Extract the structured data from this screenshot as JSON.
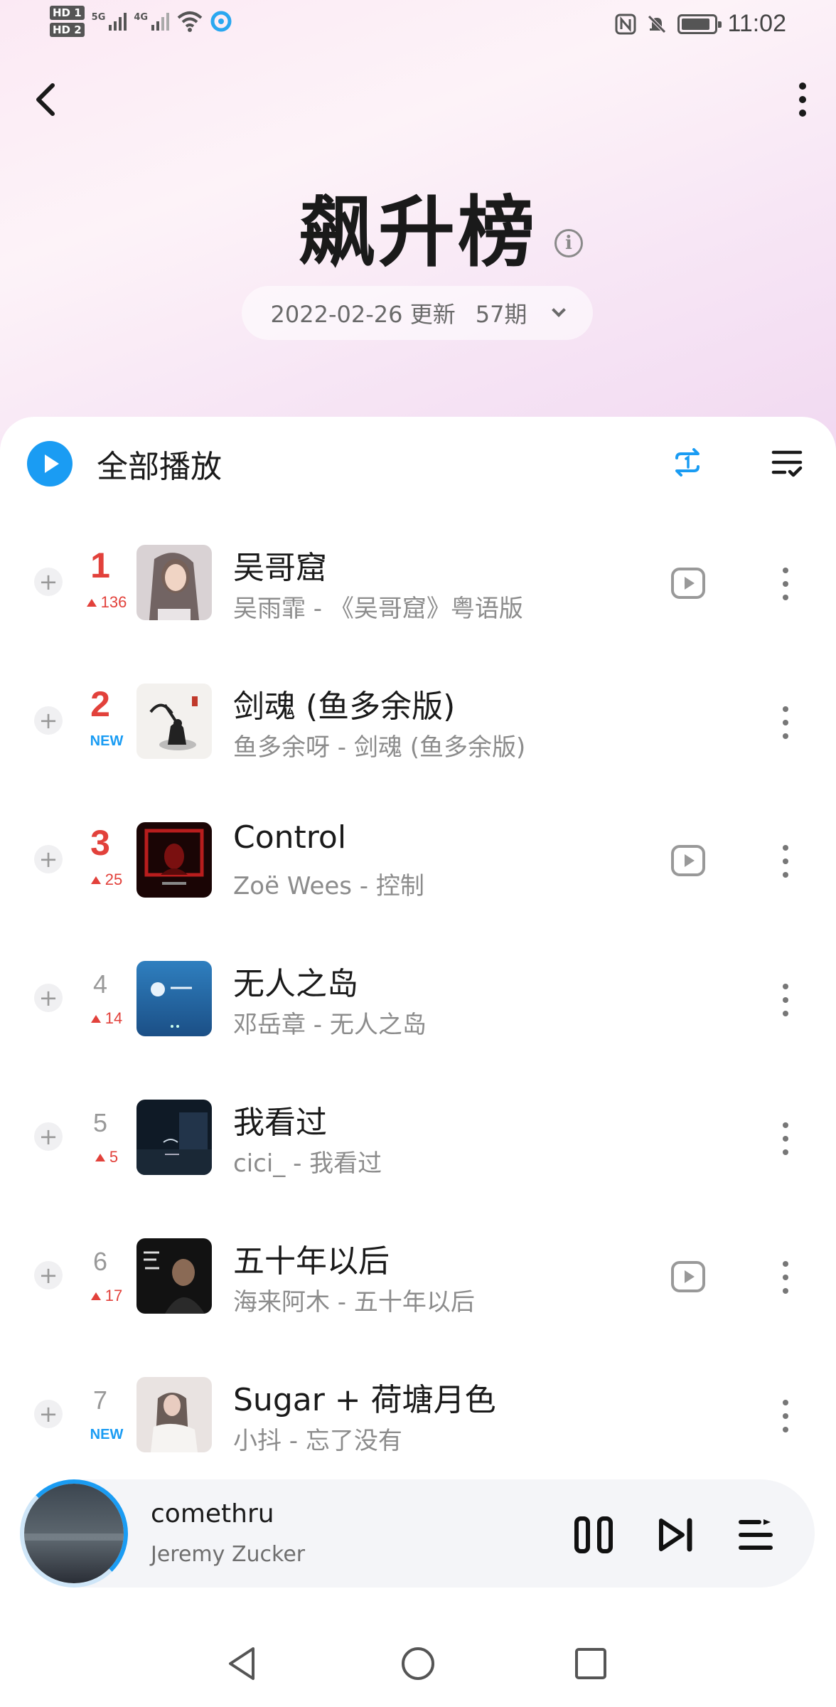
{
  "status_bar": {
    "sim1": "HD 1",
    "sim2": "HD 2",
    "network1": "5G",
    "network2": "4G",
    "time": "11:02",
    "icons": [
      "nfc-icon",
      "bell-muted-icon",
      "battery-icon"
    ]
  },
  "header": {
    "title": "飙升榜",
    "update_date": "2022-02-26 更新",
    "issue": "57期"
  },
  "toolbar": {
    "play_all_label": "全部播放"
  },
  "songs": [
    {
      "rank": "1",
      "trend": "136",
      "trend_type": "up",
      "title": "吴哥窟",
      "subtitle": "吴雨霏 - 《吴哥窟》粤语版",
      "has_mv": true
    },
    {
      "rank": "2",
      "trend": "NEW",
      "trend_type": "new",
      "title": "剑魂 (鱼多余版)",
      "subtitle": "鱼多余呀 - 剑魂 (鱼多余版)",
      "has_mv": false
    },
    {
      "rank": "3",
      "trend": "25",
      "trend_type": "up",
      "title": "Control",
      "subtitle": "Zoë Wees - 控制",
      "has_mv": true
    },
    {
      "rank": "4",
      "trend": "14",
      "trend_type": "up",
      "title": "无人之岛",
      "subtitle": "邓岳章 - 无人之岛",
      "has_mv": false
    },
    {
      "rank": "5",
      "trend": "5",
      "trend_type": "up",
      "title": "我看过",
      "subtitle": "cici_ - 我看过",
      "has_mv": false
    },
    {
      "rank": "6",
      "trend": "17",
      "trend_type": "up",
      "title": "五十年以后",
      "subtitle": "海来阿木 - 五十年以后",
      "has_mv": true
    },
    {
      "rank": "7",
      "trend": "NEW",
      "trend_type": "new",
      "title": "Sugar + 荷塘月色",
      "subtitle": "小抖 - 忘了没有",
      "has_mv": false
    }
  ],
  "player": {
    "title": "comethru",
    "artist": "Jeremy Zucker",
    "state": "playing"
  },
  "colors": {
    "accent": "#1a9cf3",
    "rank_top": "#e2413b",
    "hero_gradient": [
      "#fbe9f4",
      "#f1d9f1"
    ]
  }
}
